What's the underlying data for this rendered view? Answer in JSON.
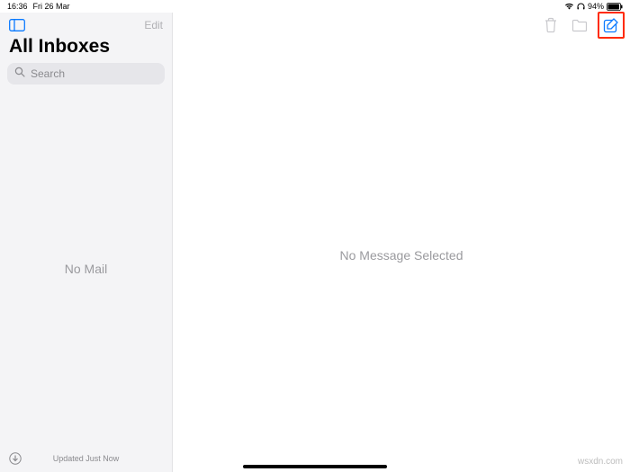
{
  "status_bar": {
    "time": "16:36",
    "date": "Fri 26 Mar",
    "battery_text": "94%"
  },
  "sidebar": {
    "edit_label": "Edit",
    "title": "All Inboxes",
    "search_placeholder": "Search",
    "empty_text": "No Mail",
    "footer_status": "Updated Just Now"
  },
  "main": {
    "empty_text": "No Message Selected"
  },
  "watermark": "wsxdn.com"
}
